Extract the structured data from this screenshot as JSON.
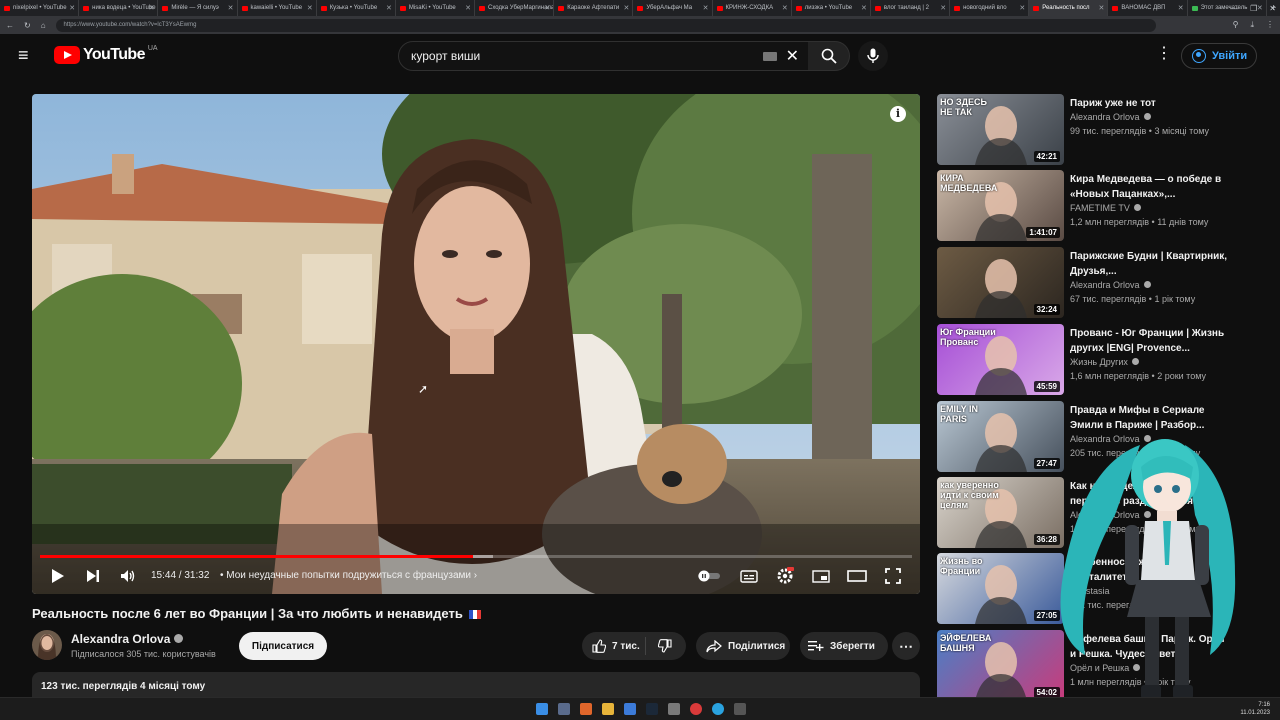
{
  "browser": {
    "tabs": [
      {
        "label": "nixelpixel • YouTube",
        "color": "#ff0000"
      },
      {
        "label": "ника водеца • YouTube",
        "color": "#ff0000"
      },
      {
        "label": "Mirèle — Я силуэ",
        "color": "#ff0000"
      },
      {
        "label": "kawaielli • YouTube",
        "color": "#ff0000"
      },
      {
        "label": "Кузька • YouTube",
        "color": "#ff0000"
      },
      {
        "label": "MisaKi • YouTube",
        "color": "#ff0000"
      },
      {
        "label": "Сходка УберМаргинала",
        "color": "#ff0000"
      },
      {
        "label": "Караоке Афтепати",
        "color": "#ff0000"
      },
      {
        "label": "УберАльфач Ма",
        "color": "#ff0000"
      },
      {
        "label": "КРИНЖ-СХОДКА",
        "color": "#ff0000"
      },
      {
        "label": "лиззка • YouTube",
        "color": "#ff0000"
      },
      {
        "label": "влог таиланд | 2",
        "color": "#ff0000"
      },
      {
        "label": "новогодний вло",
        "color": "#ff0000"
      },
      {
        "label": "Реальность посл",
        "color": "#ff0000",
        "active": true
      },
      {
        "label": "ВАНОМАС ДВП",
        "color": "#ff0000"
      },
      {
        "label": "Этот замечатель",
        "color": "#3cba54"
      }
    ],
    "url": "https://www.youtube.com/watch?v=lcT3YsAEwmg"
  },
  "header": {
    "logo_text": "YouTube",
    "country": "UA",
    "search_value": "курорт виши",
    "signin_label": "Увійти"
  },
  "player": {
    "time": "15:44 / 31:32",
    "chapter": "• Мои неудачные попытки подружиться с французами",
    "progress_played": 0.497,
    "progress_buffered_end": 0.52,
    "info_glyph": "i"
  },
  "video": {
    "title": "Реальность после 6 лет во Франции | За что любить и ненавидеть",
    "channel": "Alexandra Orlova",
    "subscribers": "Підписалося 305 тис. користувачів",
    "subscribe_label": "Підписатися",
    "likes": "7 тис.",
    "share_label": "Поділитися",
    "save_label": "Зберегти",
    "views_date": "123 тис. переглядів  4 місяці тому"
  },
  "recommendations": [
    {
      "title": "Париж уже не тот",
      "channel": "Alexandra Orlova",
      "verified": true,
      "meta": "99 тис. переглядів • 3 місяці тому",
      "duration": "42:21",
      "thumb_text": "НО ЗДЕСЬ НЕ ТАК",
      "colors": [
        "#8a8f97",
        "#3b4148"
      ]
    },
    {
      "title": "Кира Медведева — о победе в «Новых Пацанках»,...",
      "channel": "FAMETIME TV",
      "verified": true,
      "meta": "1,2 млн переглядів • 11 днів тому",
      "duration": "1:41:07",
      "thumb_text": "КИРА МЕДВЕДЕВА",
      "colors": [
        "#c9b7a6",
        "#5a4b44"
      ]
    },
    {
      "title": "Парижские Будни | Квартирник, Друзья,...",
      "channel": "Alexandra Orlova",
      "verified": true,
      "meta": "67 тис. переглядів • 1 рік тому",
      "duration": "32:24",
      "thumb_text": "",
      "colors": [
        "#6d5b44",
        "#2c2620"
      ]
    },
    {
      "title": "Прованс - Юг Франции | Жизнь других |ENG| Provence...",
      "channel": "Жизнь Других",
      "verified": true,
      "meta": "1,6 млн переглядів • 2 роки тому",
      "duration": "45:59",
      "thumb_text": "Юг Франции  Прованс",
      "colors": [
        "#a64fd6",
        "#d9a8e8"
      ]
    },
    {
      "title": "Правда и Мифы в Сериале Эмили в Париже | Разбор...",
      "channel": "Alexandra Orlova",
      "verified": true,
      "meta": "205 тис. переглядів • 1 рік тому",
      "duration": "27:47",
      "thumb_text": "EMILY IN PARIS",
      "colors": [
        "#b9c7d3",
        "#46505c"
      ]
    },
    {
      "title": "Как найти дело жизни и перестать раздражаться",
      "channel": "Alexandra Orlova",
      "verified": true,
      "meta": "107 тис. переглядів • 1 рік тому",
      "duration": "36:28",
      "thumb_text": "как уверенно идти к своим целям",
      "colors": [
        "#d9d4cc",
        "#7a6e63"
      ]
    },
    {
      "title": "Особенности жизни и менталитета",
      "channel": "Anastasia",
      "verified": false,
      "meta": "122 тис. переглядів • 1 рік тому",
      "duration": "27:05",
      "thumb_text": "Жизнь во Франции",
      "colors": [
        "#d6d9de",
        "#3a5a9a"
      ]
    },
    {
      "title": "Эйфелева башня, Париж. Орёл и Решка. Чудеса света",
      "channel": "Орёл и Решка",
      "verified": true,
      "meta": "1 млн переглядів • 1 рік тому",
      "duration": "54:02",
      "thumb_text": "ЭЙФЕЛЕВА БАШНЯ",
      "colors": [
        "#4a7fc6",
        "#c93b7b"
      ]
    }
  ],
  "taskbar": {
    "time": "7:16",
    "date": "11.01.2023"
  },
  "icons": {
    "menu": "hamburger-icon",
    "search": "search-icon",
    "mic": "microphone-icon",
    "like": "thumbs-up-icon",
    "dislike": "thumbs-down-icon",
    "share": "share-arrow-icon",
    "save": "add-to-playlist-icon",
    "more": "more-horizontal-icon"
  }
}
